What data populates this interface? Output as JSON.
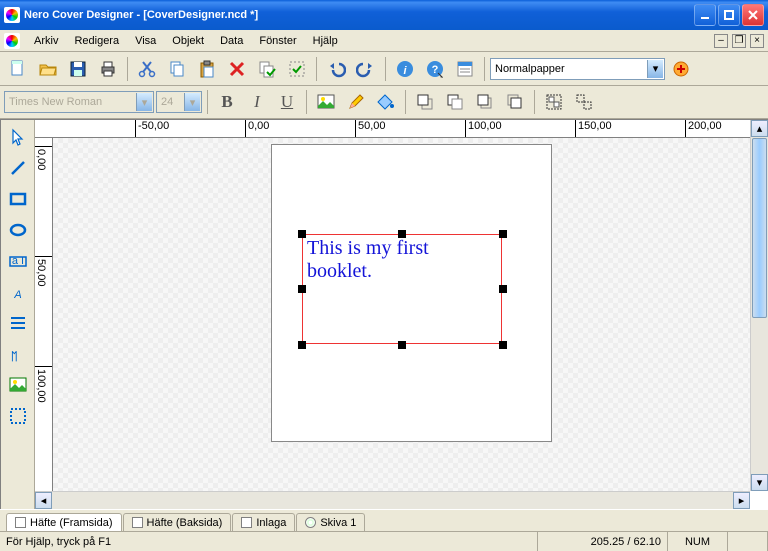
{
  "window": {
    "title": "Nero Cover Designer - [CoverDesigner.ncd *]"
  },
  "menu": {
    "file": "Arkiv",
    "edit": "Redigera",
    "view": "Visa",
    "object": "Objekt",
    "data": "Data",
    "window": "Fönster",
    "help": "Hjälp"
  },
  "toolbar": {
    "paper_label": "Normalpapper"
  },
  "format": {
    "font": "Times New Roman",
    "size": "24"
  },
  "ruler_h": {
    "t0": "-50,00",
    "t1": "0,00",
    "t2": "50,00",
    "t3": "100,00",
    "t4": "150,00",
    "t5": "200,00"
  },
  "ruler_v": {
    "t0": "0,00",
    "t1": "50,00",
    "t2": "100,00"
  },
  "textbox": {
    "content": "This is my first booklet."
  },
  "tabs": {
    "front": "Häfte (Framsida)",
    "back": "Häfte (Baksida)",
    "inlay": "Inlaga",
    "disc": "Skiva 1"
  },
  "status": {
    "help": "För Hjälp, tryck på F1",
    "coords": "205.25 / 62.10",
    "num": "NUM"
  }
}
